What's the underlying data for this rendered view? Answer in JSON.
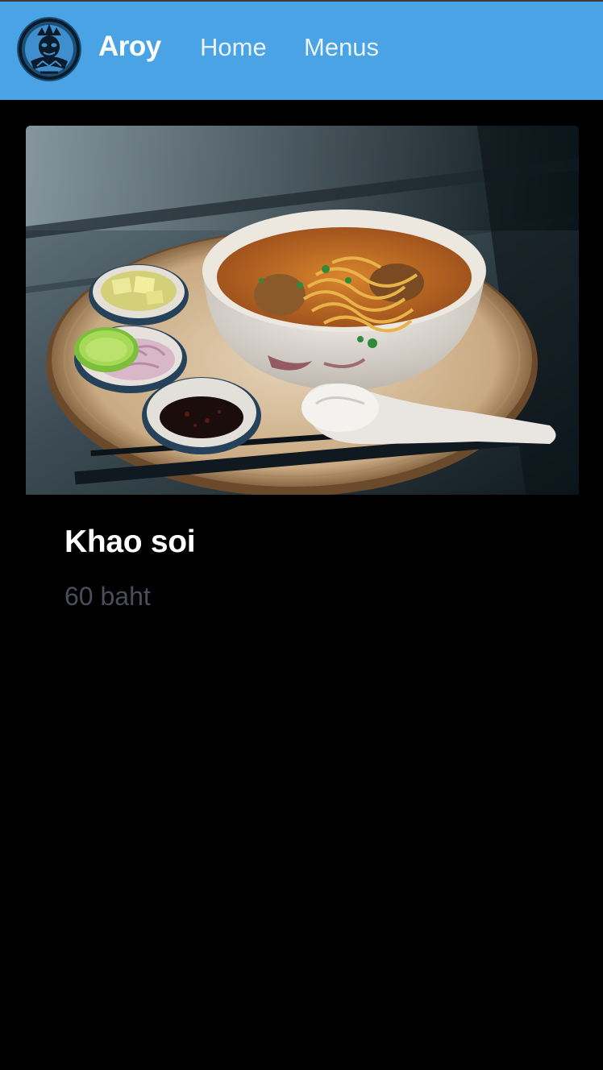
{
  "navbar": {
    "brand": "Aroy",
    "links": [
      {
        "label": "Home"
      },
      {
        "label": "Menus"
      }
    ],
    "logo_icon": "temple-mask-logo",
    "background_color": "#4aa3e4"
  },
  "menu_item": {
    "name": "Khao soi",
    "price": "60 baht",
    "image_icon": "khao-soi-photo"
  },
  "colors": {
    "page_background": "#000000",
    "price_text": "#4a4e5c"
  }
}
